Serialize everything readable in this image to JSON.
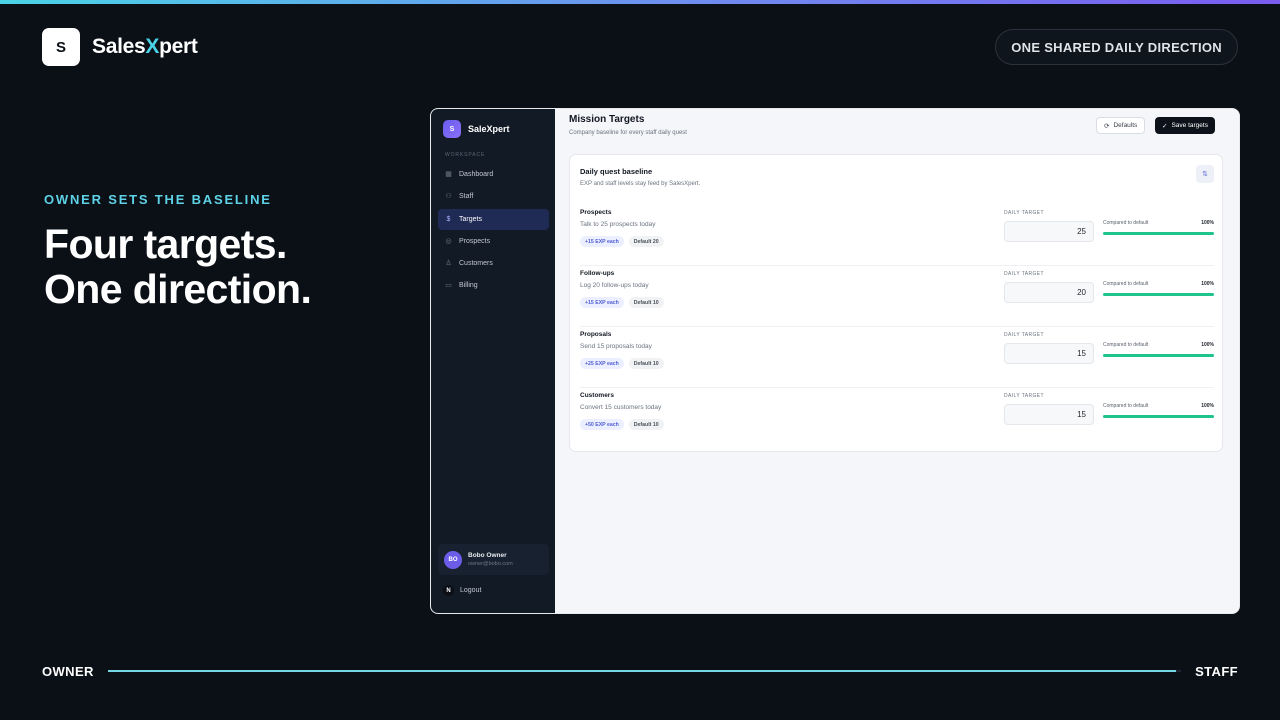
{
  "brand": {
    "logo_letter": "S",
    "name_pre": "Sales",
    "name_x": "X",
    "name_post": "pert"
  },
  "header": {
    "pill": "ONE SHARED DAILY DIRECTION"
  },
  "hero": {
    "kicker": "OWNER SETS THE BASELINE",
    "line1": "Four targets.",
    "line2": "One direction."
  },
  "progress": {
    "left_label": "OWNER",
    "right_label": "STAFF",
    "fraction": 0.995
  },
  "app": {
    "sidebar": {
      "logo_letter": "S",
      "brand": "SaleXpert",
      "section": "WORKSPACE",
      "items": [
        {
          "label": "Dashboard",
          "icon": "dashboard-icon",
          "glyph": "▦",
          "active": false
        },
        {
          "label": "Staff",
          "icon": "staff-icon",
          "glyph": "⚇",
          "active": false
        },
        {
          "label": "Targets",
          "icon": "targets-icon",
          "glyph": "$",
          "active": true
        },
        {
          "label": "Prospects",
          "icon": "prospects-icon",
          "glyph": "◎",
          "active": false
        },
        {
          "label": "Customers",
          "icon": "customers-icon",
          "glyph": "♙",
          "active": false
        },
        {
          "label": "Billing",
          "icon": "billing-icon",
          "glyph": "▭",
          "active": false
        }
      ],
      "user": {
        "initials": "BO",
        "name": "Bobo Owner",
        "email": "owner@bobo.com"
      },
      "logout_icon_letter": "N",
      "logout": "Logout"
    },
    "page": {
      "title": "Mission Targets",
      "subtitle": "Company baseline for every staff daily quest",
      "defaults_button": "Defaults",
      "save_button": "Save targets"
    },
    "card": {
      "title": "Daily quest baseline",
      "subtitle": "EXP and staff levels stay feed by SalesXpert.",
      "rows": [
        {
          "name": "Prospects",
          "desc": "Talk to 25 prospects today",
          "exp": "+15 EXP each",
          "default": "Default 20",
          "target_label": "DAILY TARGET",
          "value": "25",
          "compare_label": "Compared to default",
          "pct": "100%",
          "pct_value": 100
        },
        {
          "name": "Follow-ups",
          "desc": "Log 20 follow-ups today",
          "exp": "+15 EXP each",
          "default": "Default 10",
          "target_label": "DAILY TARGET",
          "value": "20",
          "compare_label": "Compared to default",
          "pct": "100%",
          "pct_value": 100
        },
        {
          "name": "Proposals",
          "desc": "Send 15 proposals today",
          "exp": "+25 EXP each",
          "default": "Default 10",
          "target_label": "DAILY TARGET",
          "value": "15",
          "compare_label": "Compared to default",
          "pct": "100%",
          "pct_value": 100
        },
        {
          "name": "Customers",
          "desc": "Convert 15 customers today",
          "exp": "+50 EXP each",
          "default": "Default 10",
          "target_label": "DAILY TARGET",
          "value": "15",
          "compare_label": "Compared to default",
          "pct": "100%",
          "pct_value": 100
        }
      ]
    }
  },
  "colors": {
    "accent": "#4ad3e6",
    "brand_purple": "#6a5cf0",
    "success": "#1fc48a",
    "bg": "#0b1017"
  }
}
